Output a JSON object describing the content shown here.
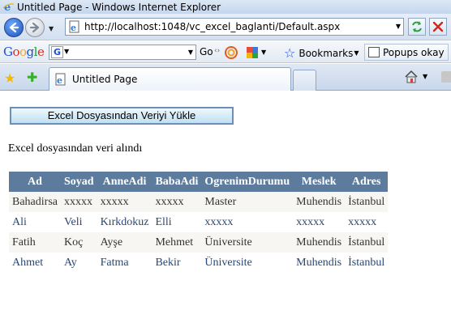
{
  "window": {
    "title": "Untitled Page - Windows Internet Explorer"
  },
  "address_bar": {
    "url": "http://localhost:1048/vc_excel_baglanti/Default.aspx"
  },
  "google_toolbar": {
    "logo": "Google",
    "search_value": "",
    "go_label": "Go",
    "bookmarks_label": "Bookmarks",
    "popups_label": "Popups okay"
  },
  "tabs": [
    {
      "label": "Untitled Page"
    }
  ],
  "page": {
    "load_button_label": "Excel Dosyasından Veriyi Yükle",
    "status_message": "Excel dosyasından veri alındı",
    "table": {
      "columns": [
        "Ad",
        "Soyad",
        "AnneAdi",
        "BabaAdi",
        "OgrenimDurumu",
        "Meslek",
        "Adres"
      ],
      "rows": [
        [
          "Bahadirsa",
          "xxxxx",
          "xxxxx",
          "xxxxx",
          "Master",
          "Muhendis",
          "İstanbul"
        ],
        [
          "Ali",
          "Veli",
          "Kırkdokuz",
          "Elli",
          "xxxxx",
          "xxxxx",
          "xxxxx"
        ],
        [
          "Fatih",
          "Koç",
          "Ayşe",
          "Mehmet",
          "Üniversite",
          "Muhendis",
          "İstanbul"
        ],
        [
          "Ahmet",
          "Ay",
          "Fatma",
          "Bekir",
          "Üniversite",
          "Muhendis",
          "İstanbul"
        ]
      ]
    }
  },
  "colors": {
    "table_header_bg": "#5d7b9d",
    "row_alt_bg": "#f7f6f3",
    "row_text_dark": "#333333",
    "row_text_blue": "#284775"
  }
}
